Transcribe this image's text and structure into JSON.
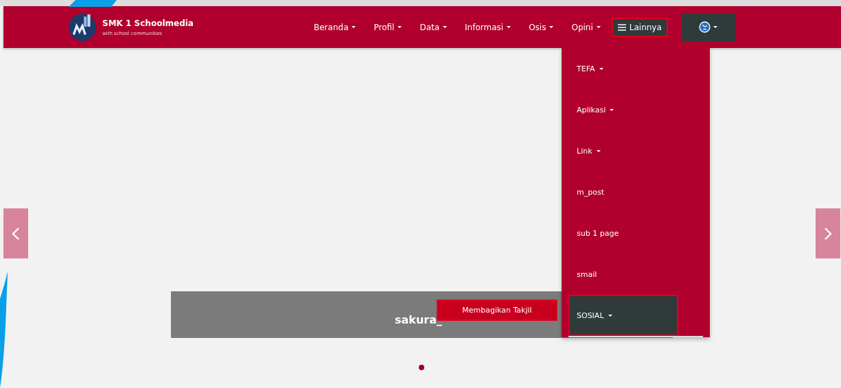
{
  "brand": {
    "title": "SMK 1 Schoolmedia",
    "tagline": "with school communities"
  },
  "nav": [
    {
      "label": "Beranda",
      "kind": "dropdown",
      "expanded": false
    },
    {
      "label": "Profil",
      "kind": "dropdown",
      "expanded": false
    },
    {
      "label": "Data",
      "kind": "dropdown",
      "expanded": false
    },
    {
      "label": "Informasi",
      "kind": "dropdown",
      "expanded": false
    },
    {
      "label": "Osis",
      "kind": "dropdown",
      "expanded": false
    },
    {
      "label": "Opini",
      "kind": "dropdown",
      "expanded": false
    },
    {
      "label": "Lainnya",
      "kind": "menu",
      "expanded": true
    }
  ],
  "dropdown": [
    {
      "label": "TEFA",
      "has_submenu": true,
      "selected": false
    },
    {
      "label": "Aplikasi",
      "has_submenu": true,
      "selected": false
    },
    {
      "label": "Link",
      "has_submenu": true,
      "selected": false
    },
    {
      "label": "m_post",
      "has_submenu": false,
      "selected": false
    },
    {
      "label": "sub 1 page",
      "has_submenu": false,
      "selected": false
    },
    {
      "label": "smail",
      "has_submenu": false,
      "selected": false
    },
    {
      "label": "SOSIAL",
      "has_submenu": true,
      "selected": true
    }
  ],
  "submenu": [
    {
      "label": "Membagikan Takjil"
    }
  ],
  "slider": {
    "caption": "sakura_",
    "dots": [
      {
        "selected": true
      }
    ]
  }
}
